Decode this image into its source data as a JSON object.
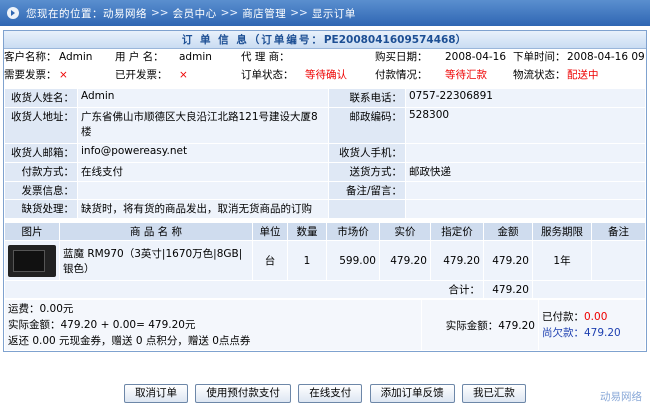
{
  "breadcrumb": [
    "您现在的位置：动易网络",
    "会员中心",
    "商店管理",
    "显示订单"
  ],
  "order": {
    "header_label": "订 单 信 息（订单编号：",
    "order_no": "PE2008041609574468",
    "header_close": "）",
    "customer_label": "客户名称：",
    "customer": "Admin",
    "username_label": "用 户 名：",
    "username": "admin",
    "agent_label": "代 理 商：",
    "agent": "",
    "purchase_label": "购买日期：",
    "purchase_date": "2008-04-16",
    "order_time_label": "下单时间：",
    "order_time": "2008-04-16 09:57:44",
    "need_invoice_label": "需要发票：",
    "need_invoice": "×",
    "issued_label": "已开发票：",
    "issued": "×",
    "status_label": "订单状态：",
    "status": "等待确认",
    "pay_label": "付款情况：",
    "pay": "等待汇款",
    "logistics_label": "物流状态：",
    "logistics": "配送中"
  },
  "receiver": {
    "name_label": "收货人姓名：",
    "name": "Admin",
    "phone_label": "联系电话：",
    "phone": "0757-22306891",
    "address_label": "收货人地址：",
    "address": "广东省佛山市顺德区大良沿江北路121号建设大厦8楼",
    "zip_label": "邮政编码：",
    "zip": "528300",
    "email_label": "收货人邮箱：",
    "email": "info@powereasy.net",
    "mobile_label": "收货人手机：",
    "mobile": "",
    "pay_method_label": "付款方式：",
    "pay_method": "在线支付",
    "ship_label": "送货方式：",
    "ship": "邮政快递",
    "invoice_label": "发票信息：",
    "invoice": "",
    "remark_label": "备注/留言：",
    "remark": "",
    "shortage_label": "缺货处理：",
    "shortage": "缺货时，将有货的商品发出，取消无货商品的订购"
  },
  "products": {
    "headers": [
      "图片",
      "商 品 名 称",
      "单位",
      "数量",
      "市场价",
      "实价",
      "指定价",
      "金额",
      "服务期限",
      "备注"
    ],
    "rows": [
      {
        "name": "蓝魔 RM970（3英寸|1670万色|8GB|银色）",
        "unit": "台",
        "qty": "1",
        "market": "599.00",
        "price": "479.20",
        "assigned": "479.20",
        "amount": "479.20",
        "service": "1年",
        "note": ""
      }
    ],
    "total_label": "合计：",
    "total": "479.20"
  },
  "summary": {
    "freight_label": "运费：",
    "freight": "0.00元",
    "actual_label": "实际金额：",
    "actual_expr": "479.20 + 0.00= 479.20元",
    "rebate_text": "返还 0.00 元现金券，赠送 0 点积分，赠送 0点点券",
    "actual2_label": "实际金额：",
    "actual2": "479.20",
    "paid_label": "已付款：",
    "paid": "0.00",
    "owed_label": "尚欠款：",
    "owed": "479.20"
  },
  "buttons": [
    "取消订单",
    "使用预付款支付",
    "在线支付",
    "添加订单反馈",
    "我已汇款"
  ],
  "footer": "动易网络"
}
